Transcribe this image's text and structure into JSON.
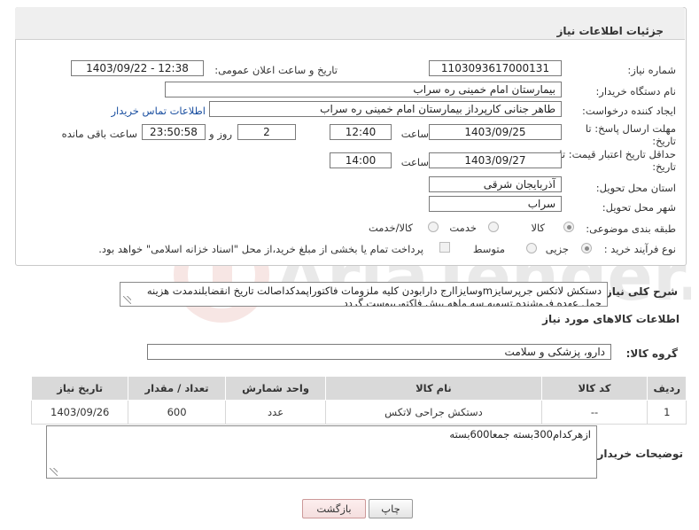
{
  "header": {
    "title": "جزئیات اطلاعات نیاز"
  },
  "form": {
    "need_number": {
      "label": "شماره نیاز:",
      "value": "1103093617000131"
    },
    "announce_date": {
      "label": "تاریخ و ساعت اعلان عمومی:",
      "value": "1403/09/22 - 12:38"
    },
    "buyer_org": {
      "label": "نام دستگاه خریدار:",
      "value": "بیمارستان امام خمینی ره  سراب"
    },
    "requester": {
      "label": "ایجاد کننده درخواست:",
      "value": "طاهر جنانی کارپرداز بیمارستان امام خمینی ره  سراب",
      "link": "اطلاعات تماس خریدار"
    },
    "reply_deadline": {
      "label_line1": "مهلت ارسال پاسخ: تا",
      "label_line2": "تاریخ:",
      "date": "1403/09/25",
      "time_label": "ساعت",
      "time": "12:40",
      "days": "2",
      "days_label": "روز و",
      "remaining": "23:50:58",
      "remaining_label": "ساعت باقی مانده"
    },
    "price_validity": {
      "label_line1": "حداقل تاریخ اعتبار قیمت: تا",
      "label_line2": "تاریخ:",
      "date": "1403/09/27",
      "time_label": "ساعت",
      "time": "14:00"
    },
    "province": {
      "label": "استان محل تحویل:",
      "value": "آذربایجان شرقی"
    },
    "city": {
      "label": "شهر محل تحویل:",
      "value": "سراب"
    },
    "category": {
      "label": "طبقه بندی موضوعی:",
      "options": [
        "کالا",
        "خدمت",
        "کالا/خدمت"
      ],
      "selected": "کالا"
    },
    "process": {
      "label": "نوع فرآیند خرید :",
      "options": [
        "جزیی",
        "متوسط"
      ],
      "selected": "جزیی",
      "payment_note": "پرداخت تمام یا بخشی از مبلغ خرید،از محل \"اسناد خزانه اسلامی\" خواهد بود."
    }
  },
  "description": {
    "label": "شرح کلی نیاز:",
    "text": "دستکش لاتکس جرپرسایزmوسایزlارج دارابودن کلیه ملزومات فاکتوراپمدکداصالت تاریخ انقضابلندمدت هزینه حمل عهده فروشنده تسویه سه ماهه پیش فاکتورپیوست گردد"
  },
  "goods_section": {
    "title": "اطلاعات کالاهای مورد نیاز",
    "group_label": "گروه کالا:",
    "group_value": "دارو، پزشکی و سلامت"
  },
  "table": {
    "headers": [
      "ردیف",
      "کد کالا",
      "نام کالا",
      "واحد شمارش",
      "تعداد / مقدار",
      "تاریخ نیاز"
    ],
    "rows": [
      [
        "1",
        "--",
        "دستکش جراحی لاتکس",
        "عدد",
        "600",
        "1403/09/26"
      ]
    ]
  },
  "buyer_notes": {
    "label": "توضیحات خریدار:",
    "text": "ازهرکدام300بسته جمعا600بسته"
  },
  "buttons": {
    "print": "چاپ",
    "back": "بازگشت"
  },
  "watermark": {
    "text": "AriaTender.neT"
  },
  "colors": {
    "header_bg": "#efefef",
    "table_header_bg": "#d9d9d9",
    "link": "#1a4fa0",
    "watermark": "#c0392b"
  }
}
